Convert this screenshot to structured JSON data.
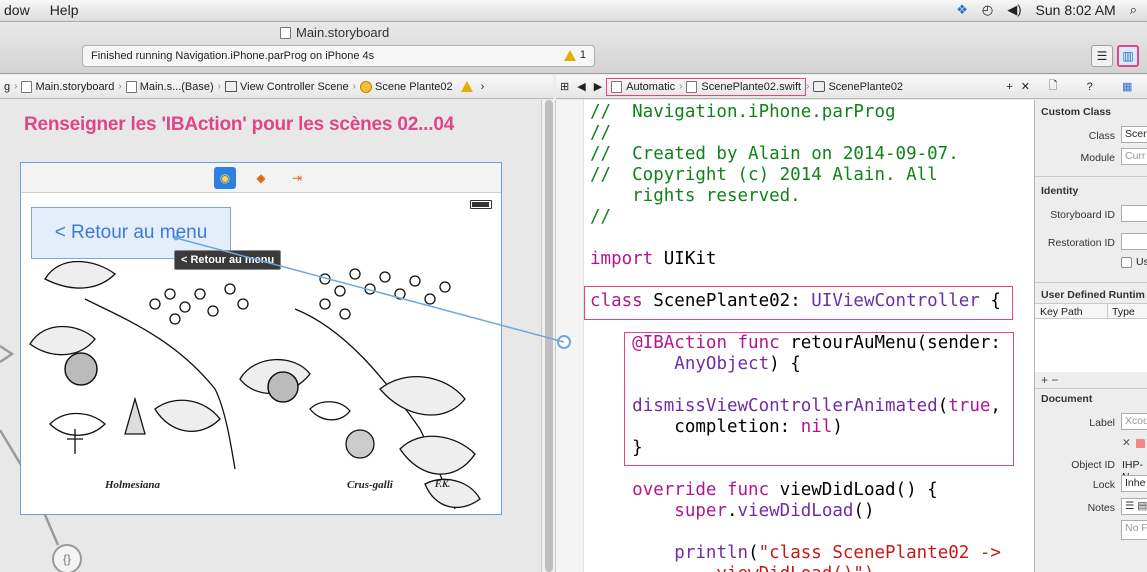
{
  "menubar": {
    "items": [
      "dow",
      "Help"
    ],
    "clock": "Sun 8:02 AM"
  },
  "toolbar": {
    "window_title": "Main.storyboard",
    "activity_text": "Finished running Navigation.iPhone.parProg on iPhone 4s",
    "warning_count": "1"
  },
  "jump_left": {
    "items": [
      "Main.storyboard",
      "Main.s...(Base)",
      "View Controller Scene",
      "Scene Plante02"
    ]
  },
  "jump_right": {
    "mode": "Automatic",
    "file": "ScenePlante02.swift",
    "symbol": "ScenePlante02"
  },
  "canvas": {
    "annotation": "Renseigner les 'IBAction' pour les scènes 02...04",
    "back_button_label": "< Retour au menu",
    "tooltip": "< Retour au menu",
    "caption_left": "Holmesiana",
    "caption_right": "Crus-galli",
    "caption_initials": "F.K."
  },
  "code": [
    [
      "//  Navigation.iPhone.parProg",
      "com"
    ],
    [
      "//",
      "com"
    ],
    [
      "//  Created by Alain on 2014-09-07.",
      "com"
    ],
    [
      "//  Copyright (c) 2014 Alain. All",
      "com"
    ],
    [
      "    rights reserved.",
      "com"
    ],
    [
      "//",
      "com"
    ],
    [
      "",
      "plain"
    ],
    [
      "import UIKit",
      "import"
    ],
    [
      "",
      "plain"
    ],
    [
      "class ScenePlante02: UIViewController {",
      "class"
    ],
    [
      "",
      "plain"
    ],
    [
      "    @IBAction func retourAuMenu(sender:",
      "action"
    ],
    [
      "        AnyObject) {",
      "anyobj"
    ],
    [
      "",
      "plain"
    ],
    [
      "    dismissViewControllerAnimated(true,",
      "dismiss"
    ],
    [
      "        completion: nil)",
      "completion"
    ],
    [
      "    }",
      "plain"
    ],
    [
      "",
      "plain"
    ],
    [
      "    override func viewDidLoad() {",
      "override"
    ],
    [
      "        super.viewDidLoad()",
      "super"
    ],
    [
      "",
      "plain"
    ],
    [
      "        println(\"class ScenePlante02 ->",
      "println"
    ],
    [
      "            viewDidLoad()\")",
      "str"
    ]
  ],
  "inspector": {
    "custom_class_header": "Custom Class",
    "class_label": "Class",
    "class_value": "Scene",
    "module_label": "Module",
    "module_value": "Curr",
    "identity_header": "Identity",
    "storyboard_id_label": "Storyboard ID",
    "restoration_id_label": "Restoration ID",
    "use_label": "Us",
    "runtime_header": "User Defined Runtim",
    "key_path_col": "Key Path",
    "type_col": "Type",
    "add_remove": "+ −",
    "document_header": "Document",
    "label_label": "Label",
    "label_value": "Xcod",
    "object_id_label": "Object ID",
    "object_id_value": "IHP-N",
    "lock_label": "Lock",
    "lock_value": "Inhe",
    "notes_label": "Notes",
    "notes_value": "No F"
  },
  "colors": {
    "highlight": "#e0448a",
    "comment": "#11821a",
    "keyword": "#b0178f",
    "type": "#6e2ea7",
    "string": "#c41a16",
    "link": "#6fa6e0"
  }
}
